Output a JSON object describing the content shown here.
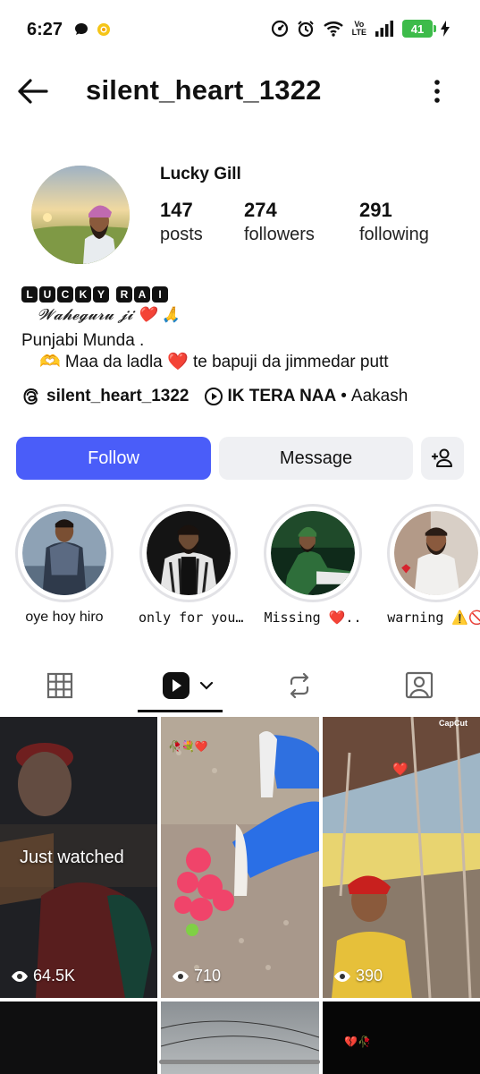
{
  "status_bar": {
    "time": "6:27",
    "battery": "41",
    "network": "Vo LTE"
  },
  "header": {
    "username": "silent_heart_1322",
    "back_icon": "arrow-left-icon",
    "more_icon": "vertical-dots-icon"
  },
  "profile": {
    "display_name": "Lucky Gill",
    "stats": [
      {
        "value": "147",
        "label": "posts"
      },
      {
        "value": "274",
        "label": "followers"
      },
      {
        "value": "291",
        "label": "following"
      }
    ],
    "bio_name_letters": [
      "L",
      "U",
      "C",
      "K",
      "Y",
      "",
      "R",
      "A",
      "I"
    ],
    "bio_line1": "𝓦𝓪𝓱𝓮𝓰𝓾𝓻𝓾 𝓳𝓲 ❤️ 🙏",
    "bio_line2": "Punjabi Munda .",
    "bio_line3": "🫶 Maa da ladla ❤️ te bapuji da jimmedar putt",
    "threads_handle": "silent_heart_1322",
    "song_title": "IK TERA NAA",
    "song_artist": "Aakash",
    "song_separator": "•"
  },
  "buttons": {
    "follow": "Follow",
    "message": "Message",
    "add_user_icon": "add-user-icon"
  },
  "highlights": [
    {
      "label": "oye hoy hiro"
    },
    {
      "label": "only for you…"
    },
    {
      "label": "Missing ❤️.."
    },
    {
      "label": "warning ⚠️🚫"
    }
  ],
  "tabs": [
    "grid-icon",
    "reels-icon",
    "reposts-icon",
    "tagged-icon"
  ],
  "posts": [
    {
      "views": "64.5K",
      "overlay": "Just watched"
    },
    {
      "views": "710",
      "overlay": "",
      "sticker": "🥀💐❤️"
    },
    {
      "views": "390",
      "overlay": "",
      "badge": "CapCut",
      "sticker": "❤️"
    },
    {
      "views": "",
      "overlay": ""
    },
    {
      "views": "",
      "overlay": ""
    },
    {
      "views": "",
      "overlay": "",
      "sticker": "💔🥀"
    }
  ],
  "colors": {
    "accent": "#4a5df9",
    "button_bg": "#eff0f3",
    "battery": "#3dbb4a"
  }
}
